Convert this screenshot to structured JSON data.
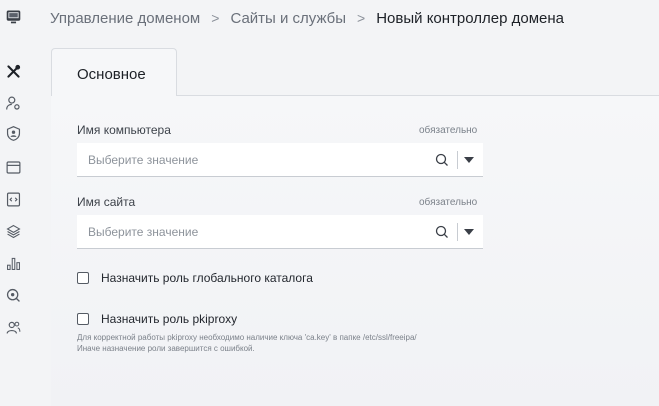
{
  "breadcrumb": {
    "items": [
      "Управление доменом",
      "Сайты и службы"
    ],
    "separator": ">",
    "current": "Новый контроллер домена"
  },
  "sidebar": {
    "icons": [
      "app-logo-icon",
      "tools-icon",
      "user-settings-icon",
      "shield-user-icon",
      "window-icon",
      "code-file-icon",
      "layers-icon",
      "bar-chart-icon",
      "search-settings-icon",
      "users-icon"
    ]
  },
  "tabs": [
    {
      "label": "Основное",
      "active": true
    }
  ],
  "form": {
    "computer_name": {
      "label": "Имя компьютера",
      "required": "обязательно",
      "placeholder": "Выберите значение"
    },
    "site_name": {
      "label": "Имя сайта",
      "required": "обязательно",
      "placeholder": "Выберите значение"
    },
    "global_catalog": {
      "label": "Назначить роль глобального каталога",
      "checked": false
    },
    "pkiproxy": {
      "label": "Назначить роль pkiproxy",
      "checked": false,
      "hint_line1": "Для корректной работы pkiproxy необходимо наличие ключа 'ca.key' в папке /etc/ssl/freeipa/",
      "hint_line2": "Иначе назначение роли завершится с ошибкой."
    }
  }
}
